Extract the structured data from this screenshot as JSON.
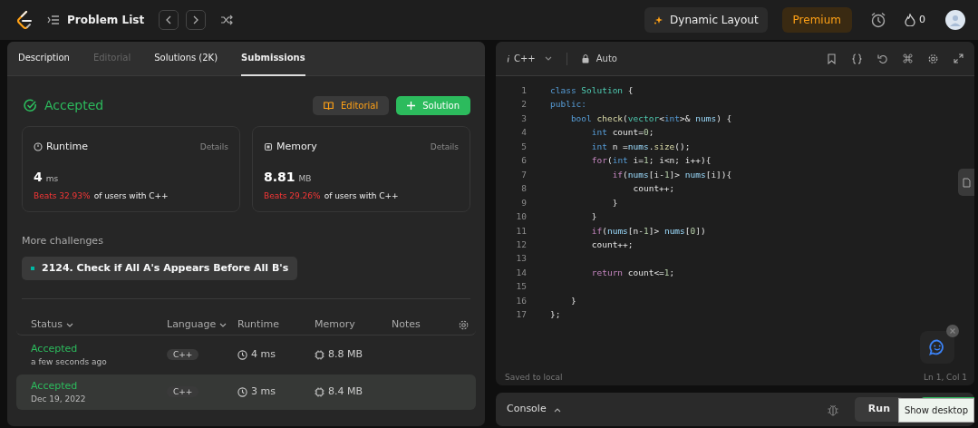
{
  "top_bar": {
    "title": "Problem List",
    "dynamic_layout": "Dynamic Layout",
    "premium": "Premium",
    "streak": "0"
  },
  "tabs": [
    {
      "label": "Description",
      "selected": false,
      "disabled": false
    },
    {
      "label": "Editorial",
      "selected": false,
      "disabled": true
    },
    {
      "label": "Solutions (2K)",
      "selected": false,
      "disabled": false
    },
    {
      "label": "Submissions",
      "selected": true,
      "disabled": false
    }
  ],
  "result": {
    "status": "Accepted",
    "editorial_button": "Editorial",
    "solution_button": "Solution"
  },
  "stats": [
    {
      "kind": "runtime",
      "label": "Runtime",
      "details": "Details",
      "value": "4",
      "unit": "ms",
      "beats": "Beats 32.93%",
      "suffix": "of users with C++"
    },
    {
      "kind": "memory",
      "label": "Memory",
      "details": "Details",
      "value": "8.81",
      "unit": "MB",
      "beats": "Beats 29.26%",
      "suffix": "of users with C++"
    }
  ],
  "more_challenges": {
    "heading": "More challenges",
    "items": [
      {
        "title": "2124. Check if All A's Appears Before All B's",
        "color": "#00b8a3"
      }
    ]
  },
  "submissions": {
    "columns": [
      {
        "kind": "text",
        "label": "Status",
        "dropdown": true
      },
      {
        "kind": "text",
        "label": "Language",
        "dropdown": true
      },
      {
        "kind": "text",
        "label": "Runtime",
        "dropdown": false
      },
      {
        "kind": "text",
        "label": "Memory",
        "dropdown": false
      },
      {
        "kind": "text",
        "label": "Notes",
        "dropdown": false
      },
      {
        "kind": "settings"
      }
    ],
    "rows": [
      {
        "status": "Accepted",
        "time": "a few seconds ago",
        "language": "C++",
        "runtime": "4 ms",
        "memory": "8.8 MB",
        "selected": false
      },
      {
        "status": "Accepted",
        "time": "Dec 19, 2022",
        "language": "C++",
        "runtime": "3 ms",
        "memory": "8.4 MB",
        "selected": true
      }
    ]
  },
  "editor": {
    "language": "C++",
    "mode": "Auto",
    "lines": [
      {
        "number": "1",
        "tokens": [
          {
            "kind": "kw",
            "text": "class"
          },
          {
            "kind": "type",
            "text": " Solution"
          },
          {
            "kind": "plain",
            "text": " {"
          }
        ]
      },
      {
        "number": "2",
        "tokens": [
          {
            "kind": "kw",
            "text": "public:"
          }
        ]
      },
      {
        "number": "3",
        "tokens": [
          {
            "kind": "kw",
            "text": "    bool"
          },
          {
            "kind": "fn",
            "text": " check"
          },
          {
            "kind": "plain",
            "text": "("
          },
          {
            "kind": "type",
            "text": "vector"
          },
          {
            "kind": "plain",
            "text": "<"
          },
          {
            "kind": "kw",
            "text": "int"
          },
          {
            "kind": "plain",
            "text": ">& "
          },
          {
            "kind": "var",
            "text": "nums"
          },
          {
            "kind": "plain",
            "text": ") {"
          }
        ]
      },
      {
        "number": "4",
        "tokens": [
          {
            "kind": "kw",
            "text": "        int"
          },
          {
            "kind": "plain",
            "text": " count="
          },
          {
            "kind": "num",
            "text": "0"
          },
          {
            "kind": "plain",
            "text": ";"
          }
        ]
      },
      {
        "number": "5",
        "tokens": [
          {
            "kind": "kw",
            "text": "        int"
          },
          {
            "kind": "plain",
            "text": " n ="
          },
          {
            "kind": "var",
            "text": "nums"
          },
          {
            "kind": "plain",
            "text": "."
          },
          {
            "kind": "fn",
            "text": "size"
          },
          {
            "kind": "plain",
            "text": "();"
          }
        ]
      },
      {
        "number": "6",
        "tokens": [
          {
            "kind": "ctrl",
            "text": "        for"
          },
          {
            "kind": "plain",
            "text": "("
          },
          {
            "kind": "kw",
            "text": "int"
          },
          {
            "kind": "plain",
            "text": " i="
          },
          {
            "kind": "num",
            "text": "1"
          },
          {
            "kind": "plain",
            "text": "; i<n; i++){"
          }
        ]
      },
      {
        "number": "7",
        "tokens": [
          {
            "kind": "ctrl",
            "text": "            if"
          },
          {
            "kind": "plain",
            "text": "("
          },
          {
            "kind": "var",
            "text": "nums"
          },
          {
            "kind": "plain",
            "text": "[i-"
          },
          {
            "kind": "num",
            "text": "1"
          },
          {
            "kind": "plain",
            "text": "]> "
          },
          {
            "kind": "var",
            "text": "nums"
          },
          {
            "kind": "plain",
            "text": "[i]){"
          }
        ]
      },
      {
        "number": "8",
        "tokens": [
          {
            "kind": "plain",
            "text": "                count++;"
          }
        ]
      },
      {
        "number": "9",
        "tokens": [
          {
            "kind": "plain",
            "text": "            }"
          }
        ]
      },
      {
        "number": "10",
        "tokens": [
          {
            "kind": "plain",
            "text": "        }"
          }
        ]
      },
      {
        "number": "11",
        "tokens": [
          {
            "kind": "ctrl",
            "text": "        if"
          },
          {
            "kind": "plain",
            "text": "("
          },
          {
            "kind": "var",
            "text": "nums"
          },
          {
            "kind": "plain",
            "text": "[n-"
          },
          {
            "kind": "num",
            "text": "1"
          },
          {
            "kind": "plain",
            "text": "]> "
          },
          {
            "kind": "var",
            "text": "nums"
          },
          {
            "kind": "plain",
            "text": "["
          },
          {
            "kind": "num",
            "text": "0"
          },
          {
            "kind": "plain",
            "text": "])"
          }
        ]
      },
      {
        "number": "12",
        "tokens": [
          {
            "kind": "plain",
            "text": "        count++;"
          }
        ]
      },
      {
        "number": "13"
      },
      {
        "number": "14",
        "tokens": [
          {
            "kind": "ctrl",
            "text": "        return"
          },
          {
            "kind": "plain",
            "text": " count<="
          },
          {
            "kind": "num",
            "text": "1"
          },
          {
            "kind": "plain",
            "text": ";"
          }
        ]
      },
      {
        "number": "15"
      },
      {
        "number": "16",
        "tokens": [
          {
            "kind": "plain",
            "text": "    }"
          }
        ]
      },
      {
        "number": "17",
        "tokens": [
          {
            "kind": "plain",
            "text": "};"
          }
        ]
      }
    ],
    "status_left": "Saved to local",
    "status_right": "Ln 1, Col 1"
  },
  "console": {
    "label": "Console",
    "run": "Run"
  },
  "tooltip": "Show desktop"
}
